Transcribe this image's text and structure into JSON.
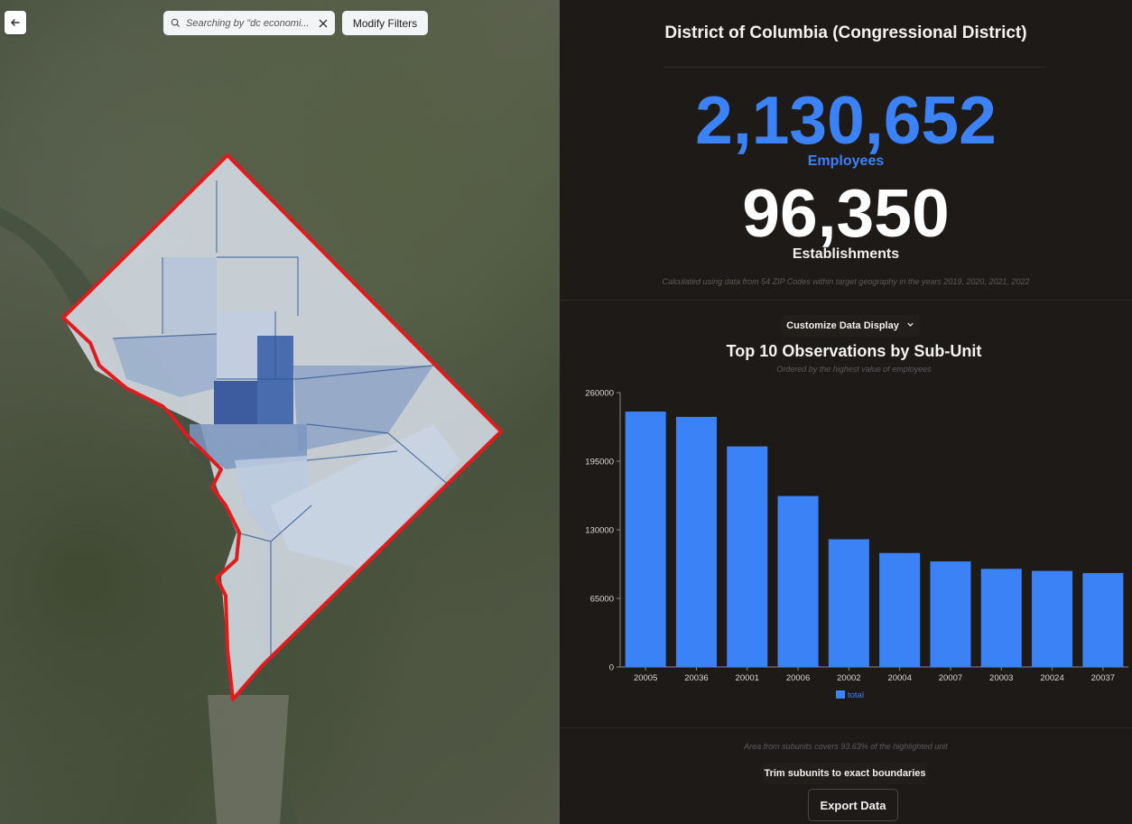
{
  "map": {
    "search_text": "Searching by \"dc economi...",
    "filters_label": "Modify Filters"
  },
  "panel": {
    "title": "District of Columbia (Congressional District)",
    "employees_value": "2,130,652",
    "employees_label": "Employees",
    "establishments_value": "96,350",
    "establishments_label": "Establishments",
    "calc_note": "Calculated using data from 54 ZIP Codes within target geography in the years 2019, 2020, 2021, 2022",
    "customize_label": "Customize Data Display",
    "chart_title": "Top 10 Observations by Sub-Unit",
    "chart_subtitle": "Ordered by the highest value of employees",
    "area_note": "Area from subunits covers 93.63% of the highlighted unit",
    "trim_label": "Trim subunits to exact boundaries",
    "export_label": "Export Data"
  },
  "colors": {
    "accent": "#3b82f6",
    "boundary": "#e11b1b",
    "panel_bg": "#1e1a18"
  },
  "chart_data": {
    "type": "bar",
    "categories": [
      "20005",
      "20036",
      "20001",
      "20006",
      "20002",
      "20004",
      "20007",
      "20003",
      "20024",
      "20037"
    ],
    "series": [
      {
        "name": "total",
        "values": [
          242000,
          237000,
          209000,
          162000,
          121000,
          108000,
          100000,
          93000,
          91000,
          89000
        ]
      }
    ],
    "ylim": [
      0,
      260000
    ],
    "yticks": [
      0,
      65000,
      130000,
      195000,
      260000
    ],
    "legend": "bottom-center",
    "grid": false
  }
}
